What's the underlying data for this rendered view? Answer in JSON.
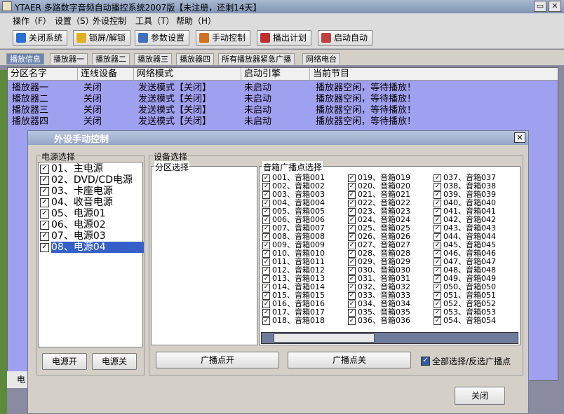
{
  "window": {
    "title": "YTAER  多路数字音频自动播控系统2007版【未注册，还剩14天】",
    "minimize_label": "▭",
    "close_label": "✕"
  },
  "menu": [
    "操作（F）",
    "设置（S）",
    "外设控制",
    "工具（T）",
    "帮助（H）"
  ],
  "toolbar": [
    {
      "label": "关闭系统",
      "icon": "power-icon",
      "color": "#2a6fd6"
    },
    {
      "label": "锁屏/解锁",
      "icon": "lock-icon",
      "color": "#e0b020"
    },
    {
      "label": "参数设置",
      "icon": "settings-icon",
      "color": "#4070c0"
    },
    {
      "label": "手动控制",
      "icon": "control-icon",
      "color": "#d07020"
    },
    {
      "label": "播出计划",
      "icon": "schedule-icon",
      "color": "#c03030"
    },
    {
      "label": "启动自动",
      "icon": "auto-start-icon",
      "color": "#c04040"
    }
  ],
  "tabs": [
    "播放信息",
    "播放器一",
    "播放器二",
    "播放器三",
    "播放器四",
    "所有播放器紧急广播",
    "网络电台"
  ],
  "grid": {
    "columns": [
      "分区名字",
      "连线设备",
      "网络模式",
      "启动引擎",
      "当前节目"
    ],
    "rows": [
      [
        "播放器一",
        "关闭",
        "发送模式【关闭】",
        "未启动",
        "播放器空闲，等待播放！"
      ],
      [
        "播放器二",
        "关闭",
        "发送模式【关闭】",
        "未启动",
        "播放器空闲，等待播放！"
      ],
      [
        "播放器三",
        "关闭",
        "发送模式【关闭】",
        "未启动",
        "播放器空闲，等待播放！"
      ],
      [
        "播放器四",
        "关闭",
        "发送模式【关闭】",
        "未启动",
        "播放器空闲，等待播放！"
      ]
    ]
  },
  "bottom_status": "电",
  "dialog": {
    "title": "外设手动控制",
    "close_label": "✕",
    "power_group_label": "电源选择",
    "power_items": [
      "01、主电源",
      "02、DVD/CD电源",
      "03、卡座电源",
      "04、收音电源",
      "05、电源01",
      "06、电源02",
      "07、电源03",
      "08、电源04"
    ],
    "power_selected_index": 7,
    "power_on_label": "电源开",
    "power_off_label": "电源关",
    "device_group_label": "设备选择",
    "zone_group_label": "分区选择",
    "speaker_group_label": "音箱广播点选择",
    "speakers": [
      "001、音箱001",
      "002、音箱002",
      "003、音箱003",
      "004、音箱004",
      "005、音箱005",
      "006、音箱006",
      "007、音箱007",
      "008、音箱008",
      "009、音箱009",
      "010、音箱010",
      "011、音箱011",
      "012、音箱012",
      "013、音箱013",
      "014、音箱014",
      "015、音箱015",
      "016、音箱016",
      "017、音箱017",
      "018、音箱018",
      "019、音箱019",
      "020、音箱020",
      "021、音箱021",
      "022、音箱022",
      "023、音箱023",
      "024、音箱024",
      "025、音箱025",
      "026、音箱026",
      "027、音箱027",
      "028、音箱028",
      "029、音箱029",
      "030、音箱030",
      "031、音箱031",
      "032、音箱032",
      "033、音箱033",
      "034、音箱034",
      "035、音箱035",
      "036、音箱036",
      "037、音箱037",
      "038、音箱038",
      "039、音箱039",
      "040、音箱040",
      "041、音箱041",
      "042、音箱042",
      "043、音箱043",
      "044、音箱044",
      "045、音箱045",
      "046、音箱046",
      "047、音箱047",
      "048、音箱048",
      "049、音箱049",
      "050、音箱050",
      "051、音箱051",
      "052、音箱052",
      "053、音箱053",
      "054、音箱054"
    ],
    "broadcast_on_label": "广播点开",
    "broadcast_off_label": "广播点关",
    "select_all_label": "全部选择/反选广播点",
    "close_button_label": "关闭",
    "check_mark": "✓"
  }
}
